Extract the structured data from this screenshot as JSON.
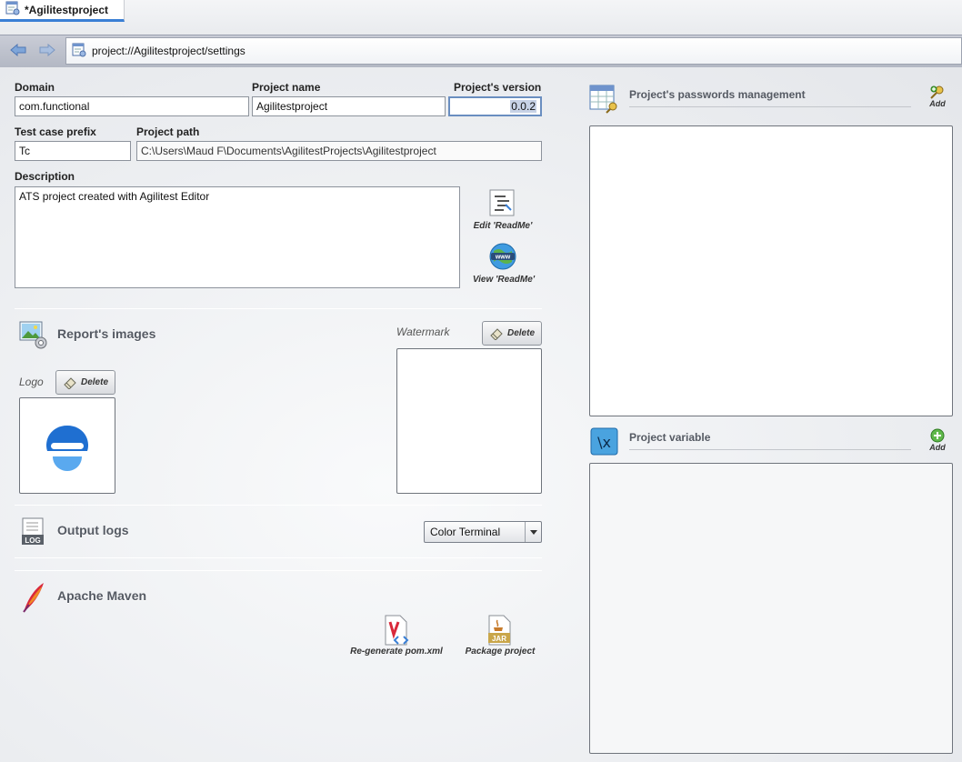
{
  "tab": {
    "title": "*Agilitestproject",
    "icon": "project-settings-icon"
  },
  "nav": {
    "back_icon": "back-arrow-icon",
    "forward_icon": "forward-arrow-icon",
    "address": "project://Agilitestproject/settings",
    "address_icon": "project-settings-icon"
  },
  "form": {
    "domain": {
      "label": "Domain",
      "value": "com.functional"
    },
    "project_name": {
      "label": "Project name",
      "value": "Agilitestproject"
    },
    "version": {
      "label": "Project's version",
      "value": "0.0.2"
    },
    "test_case_prefix": {
      "label": "Test case prefix",
      "value": "Tc"
    },
    "project_path": {
      "label": "Project path",
      "value": "C:\\Users\\Maud F\\Documents\\AgilitestProjects\\Agilitestproject"
    },
    "description": {
      "label": "Description",
      "value": "ATS project created with Agilitest Editor"
    }
  },
  "readme": {
    "edit_label": "Edit 'ReadMe'",
    "view_label": "View 'ReadMe'"
  },
  "report_images": {
    "title": "Report's images",
    "logo_label": "Logo",
    "watermark_label": "Watermark",
    "delete_label": "Delete"
  },
  "output_logs": {
    "title": "Output logs",
    "selected": "Color Terminal"
  },
  "maven": {
    "title": "Apache Maven",
    "regenerate_label": "Re-generate pom.xml",
    "package_label": "Package project"
  },
  "passwords": {
    "title": "Project's passwords management",
    "add_label": "Add"
  },
  "variables": {
    "title": "Project variable",
    "add_label": "Add"
  },
  "colors": {
    "accent": "#3a7fd5",
    "logo_blue": "#1f6fd1",
    "logo_light": "#5aa9ef"
  }
}
